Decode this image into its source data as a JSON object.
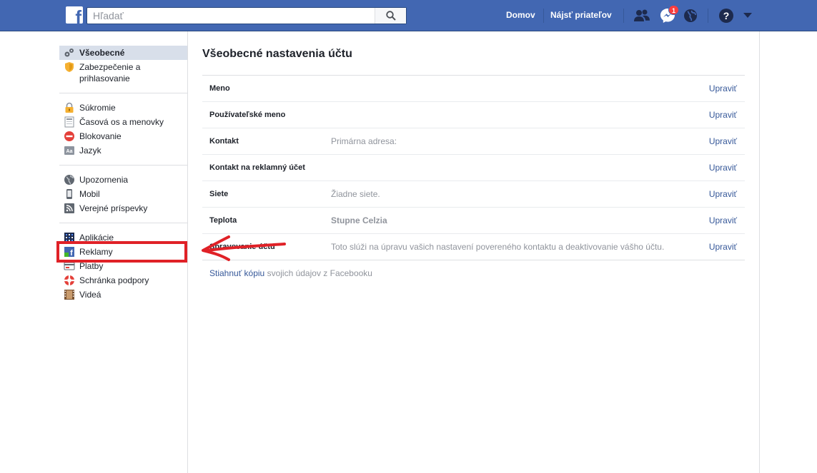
{
  "header": {
    "search_placeholder": "Hľadať",
    "nav_home": "Domov",
    "nav_find_friends": "Nájsť priateľov",
    "messages_badge": "1"
  },
  "sidebar": {
    "groups": [
      [
        {
          "label": "Všeobecné",
          "icon": "gears-icon",
          "active": true
        },
        {
          "label": "Zabezpečenie a prihlasovanie",
          "icon": "security-badge-icon"
        }
      ],
      [
        {
          "label": "Súkromie",
          "icon": "lock-icon"
        },
        {
          "label": "Časová os a menovky",
          "icon": "timeline-icon"
        },
        {
          "label": "Blokovanie",
          "icon": "block-icon"
        },
        {
          "label": "Jazyk",
          "icon": "language-icon"
        }
      ],
      [
        {
          "label": "Upozornenia",
          "icon": "globe-icon"
        },
        {
          "label": "Mobil",
          "icon": "mobile-icon"
        },
        {
          "label": "Verejné príspevky",
          "icon": "rss-icon"
        }
      ],
      [
        {
          "label": "Aplikácie",
          "icon": "apps-icon"
        },
        {
          "label": "Reklamy",
          "icon": "ads-icon"
        },
        {
          "label": "Platby",
          "icon": "payments-icon"
        },
        {
          "label": "Schránka podpory",
          "icon": "support-icon"
        },
        {
          "label": "Videá",
          "icon": "film-icon"
        }
      ]
    ]
  },
  "main": {
    "title": "Všeobecné nastavenia účtu",
    "edit_label": "Upraviť",
    "rows": [
      {
        "label": "Meno",
        "value": "",
        "style": "blurred"
      },
      {
        "label": "Používateľské meno",
        "value": "",
        "style": "blurred"
      },
      {
        "label": "Kontakt",
        "value": "Primárna adresa:",
        "style": "normal"
      },
      {
        "label": "Kontakt na reklamný účet",
        "value": "",
        "style": "blurred"
      },
      {
        "label": "Siete",
        "value": "Žiadne siete.",
        "style": "normal"
      },
      {
        "label": "Teplota",
        "value": "Stupne Celzia",
        "style": "bold"
      },
      {
        "label": "Spravovanie účtu",
        "value": "Toto slúži na úpravu vašich nastavení povereného kontaktu a deaktivovanie vášho účtu.",
        "style": "normal"
      }
    ],
    "download_link": "Stiahnuť kópiu",
    "download_rest": " svojich údajov z Facebooku"
  },
  "colors": {
    "brand": "#4267b2",
    "link": "#365899",
    "highlight": "#e02127"
  }
}
